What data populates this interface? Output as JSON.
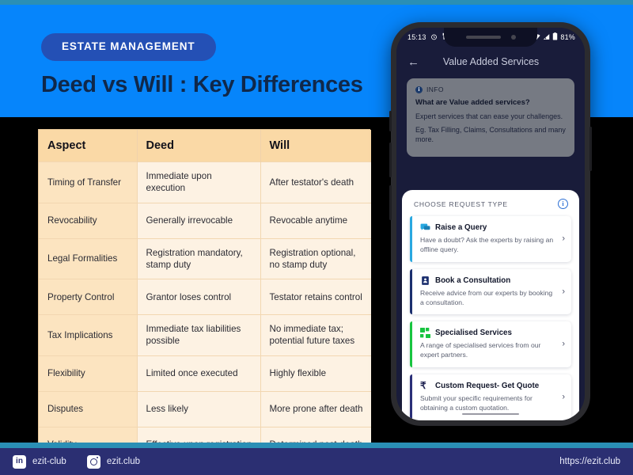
{
  "colors": {
    "header_blue": "#0685fb",
    "badge_blue": "#2450b5",
    "headline_navy": "#10284a",
    "table_header": "#fad9a6",
    "table_aspect_cell": "#fce4c0",
    "table_value_cell": "#fdf2e3",
    "footer_navy": "#2b2f72",
    "teal_strip": "#2a8fb5",
    "phone_screen_navy": "#191c3a",
    "accent_query_blue": "#29a8e0",
    "accent_consult_navy": "#1b2f6e",
    "accent_specialised_green": "#18c440",
    "accent_custom_indigo": "#2a2f78"
  },
  "header": {
    "badge": "ESTATE MANAGEMENT",
    "headline": "Deed vs Will : Key Differences"
  },
  "table": {
    "columns": [
      "Aspect",
      "Deed",
      "Will"
    ],
    "rows": [
      [
        "Timing of Transfer",
        "Immediate upon execution",
        "After testator's death"
      ],
      [
        "Revocability",
        "Generally irrevocable",
        "Revocable anytime"
      ],
      [
        "Legal Formalities",
        "Registration mandatory, stamp duty",
        "Registration optional, no stamp duty"
      ],
      [
        "Property Control",
        "Grantor loses control",
        "Testator retains control"
      ],
      [
        "Tax Implications",
        "Immediate tax liabilities possible",
        "No immediate tax; potential future taxes"
      ],
      [
        "Flexibility",
        "Limited once executed",
        "Highly flexible"
      ],
      [
        "Disputes",
        "Less likely",
        "More prone after death"
      ],
      [
        "Validity",
        "Effective upon registration",
        "Determined post-death"
      ]
    ]
  },
  "phone": {
    "status_bar": {
      "time": "15:13",
      "battery": "81%"
    },
    "app_header": {
      "back": "←",
      "title": "Value Added Services"
    },
    "info_card": {
      "badge": "INFO",
      "question": "What are Value added services?",
      "line1": "Expert services that can ease your challenges.",
      "line2": "Eg. Tax Filling, Claims, Consultations and many more."
    },
    "sheet": {
      "title": "CHOOSE REQUEST TYPE",
      "options": [
        {
          "title": "Raise a Query",
          "desc": "Have a doubt? Ask the experts by raising an offline query.",
          "icon": "chat-bubble-icon",
          "accent": "#29a8e0"
        },
        {
          "title": "Book a Consultation",
          "desc": "Receive advice from our experts by booking a consultation.",
          "icon": "document-person-icon",
          "accent": "#1b2f6e"
        },
        {
          "title": "Specialised Services",
          "desc": "A range of specialised services from our expert partners.",
          "icon": "grid-squares-icon",
          "accent": "#18c440"
        },
        {
          "title": "Custom Request- Get Quote",
          "desc": "Submit your specific requirements for obtaining a custom quotation.",
          "icon": "rupee-icon",
          "accent": "#2a2f78"
        }
      ]
    }
  },
  "footer": {
    "linkedin_handle": "ezit-club",
    "instagram_handle": "ezit.club",
    "url": "https://ezit.club"
  }
}
